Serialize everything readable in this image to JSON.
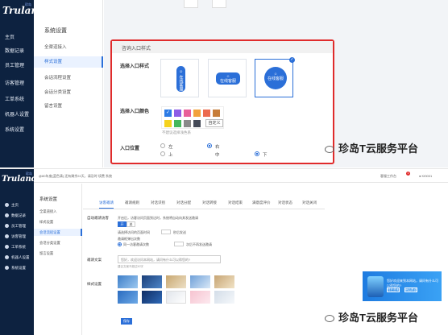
{
  "top": {
    "brand": {
      "logo": "Truland",
      "badge": "珍岛"
    },
    "dark_nav": [
      "主页",
      "数据记录",
      "员工管理",
      "访客管理",
      "工单系统",
      "机器人设置",
      "系统设置"
    ],
    "sub_nav": {
      "title": "系统设置",
      "items": [
        "全渠道接入",
        "样式设置",
        "会话流程设置",
        "会话分类设置",
        "留言设置"
      ],
      "active_index": 1
    },
    "panel": {
      "header": "咨询入口样式",
      "style_label": "选择入口样式",
      "style_card_texts": [
        "在线客服",
        "在线客服",
        "在线客服"
      ],
      "selected_style_index": 2,
      "color_label": "选择入口颜色",
      "colors": [
        "#2c7be5",
        "#8e5ce6",
        "#e8609a",
        "#f2a23c",
        "#ec6b4f",
        "#c77d3a",
        "#f5d21c",
        "#45b85c",
        "#8a8a8a",
        "#444a57"
      ],
      "custom_color_button": "自定义",
      "color_hint": "不建议选择浅色系",
      "position_label": "入口位置",
      "positions": [
        "左",
        "右",
        "上",
        "中",
        "下"
      ],
      "selected_positions": [
        "右",
        "下"
      ]
    },
    "watermark": "珍岛T云服务平台"
  },
  "bottom": {
    "brand": {
      "logo": "Truland",
      "badge": "珍岛"
    },
    "dark_nav": [
      "主页",
      "数据记录",
      "员工管理",
      "访客管理",
      "工单系统",
      "机器人设置",
      "系统设置"
    ],
    "topbar": {
      "notice": "@80年度(蓝色清) 还有剩余22天，请及时 续费 系统",
      "ticket_label": "客服工作台",
      "ticket_count": "1",
      "user": "Kf0001"
    },
    "sub_nav": {
      "title": "系统设置",
      "items": [
        "全渠道接入",
        "样式设置",
        "会话流程设置",
        "会话分类设置",
        "留言设置"
      ],
      "active_index": 2
    },
    "tabs": [
      "访客邀请",
      "邀请规则",
      "对话识别",
      "对话分配",
      "对话转接",
      "对话结束",
      "满意度评价",
      "对话状态",
      "对话关闭"
    ],
    "active_tab_index": 0,
    "form": {
      "auto_invite_label": "自动邀请访客",
      "auto_invite_desc": "开启后，访客访问页面到达时，系统将自动向其发送邀请",
      "switch": [
        "开",
        "关"
      ],
      "rule1": "请选择访问的页面时间",
      "rule1_unit": "秒后发送",
      "rule2": "邀请框弹出次数",
      "rule3": "同一访客邀请次数",
      "rule3_unit": "次后不再发送邀请",
      "invite_text_label": "邀请文案",
      "invite_text_placeholder": "您好，欢迎访问本网站，请问有什么可以帮您的?",
      "invite_hint": "建议文案不超过50字",
      "style_label": "样式设置",
      "save": "保存"
    },
    "popup": {
      "text": "您好欢迎来到本网站，请问有什么可以帮您的?",
      "buttons": [
        "现在咨询",
        "稍后再说"
      ]
    },
    "watermark": "珍岛T云服务平台"
  }
}
